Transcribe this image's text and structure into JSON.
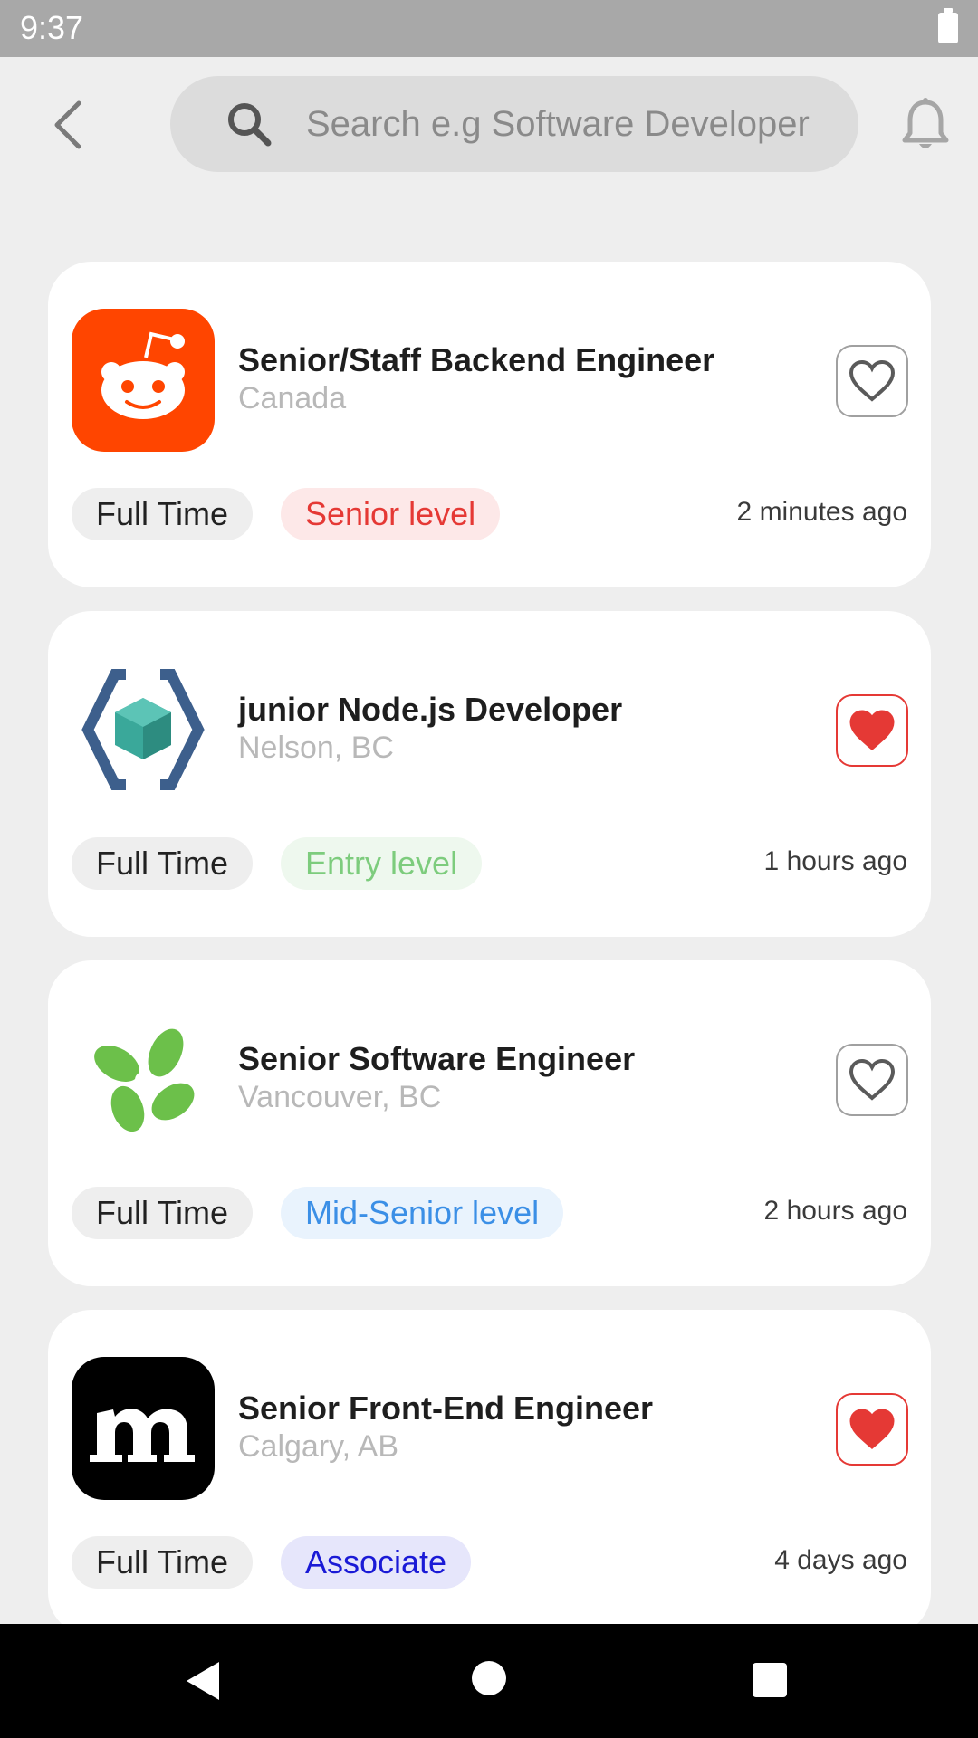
{
  "status_bar": {
    "time": "9:37"
  },
  "search": {
    "placeholder": "Search e.g Software Developer"
  },
  "jobs": [
    {
      "title": "Senior/Staff Backend Engineer",
      "location": "Canada",
      "type": "Full Time",
      "level": "Senior level",
      "posted": "2 minutes ago",
      "favorited": false,
      "logo": "reddit-logo-icon",
      "level_text_color": "#e53935",
      "level_bg_color": "#fde8e8"
    },
    {
      "title": "junior Node.js Developer",
      "location": "Nelson, BC",
      "type": "Full Time",
      "level": "Entry level",
      "posted": "1 hours ago",
      "favorited": true,
      "logo": "hexagon-cube-logo-icon",
      "level_text_color": "#7dcc7d",
      "level_bg_color": "#eef8ee"
    },
    {
      "title": "Senior Software Engineer",
      "location": "Vancouver, BC",
      "type": "Full Time",
      "level": "Mid-Senior level",
      "posted": "2 hours ago",
      "favorited": false,
      "logo": "green-petals-logo-icon",
      "level_text_color": "#3b8fe6",
      "level_bg_color": "#e9f3fd"
    },
    {
      "title": "Senior Front-End Engineer",
      "location": "Calgary, AB",
      "type": "Full Time",
      "level": "Associate",
      "posted": "4 days ago",
      "favorited": true,
      "logo": "m-letter-logo-icon",
      "level_text_color": "#1a1ad6",
      "level_bg_color": "#e6e6fb"
    }
  ],
  "colors": {
    "accent_red": "#e53935",
    "status_bar": "#a8a8a8",
    "background": "#eeeeee"
  }
}
